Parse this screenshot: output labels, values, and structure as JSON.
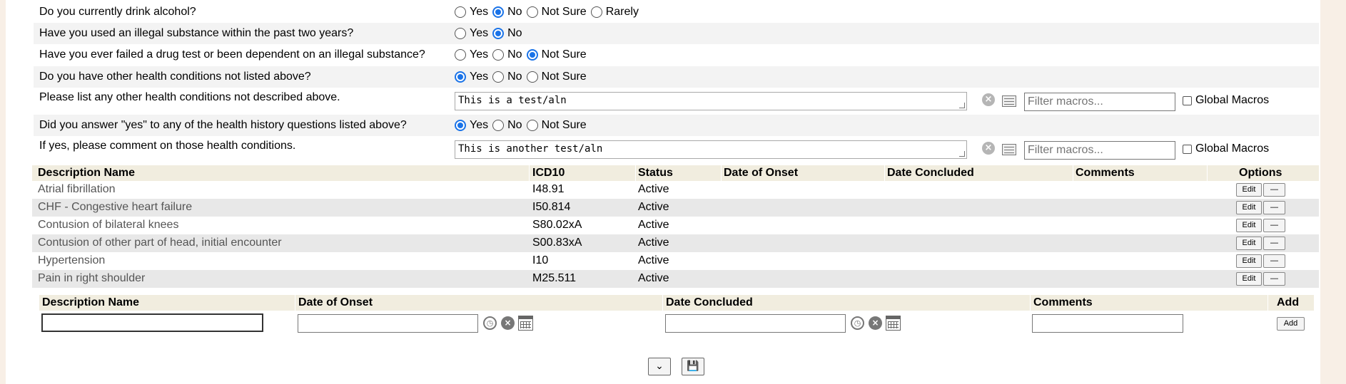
{
  "questions": [
    {
      "label": "Do you currently drink alcohol?",
      "options": [
        "Yes",
        "No",
        "Not Sure",
        "Rarely"
      ],
      "selected": "No"
    },
    {
      "label": "Have you used an illegal substance within the past two years?",
      "options": [
        "Yes",
        "No"
      ],
      "selected": "No"
    },
    {
      "label": "Have you ever failed a drug test or been dependent on an illegal substance?",
      "options": [
        "Yes",
        "No",
        "Not Sure"
      ],
      "selected": "Not Sure"
    },
    {
      "label": "Do you have other health conditions not listed above?",
      "options": [
        "Yes",
        "No",
        "Not Sure"
      ],
      "selected": "Yes"
    },
    {
      "label": "Did you answer \"yes\" to any of the health history questions listed above?",
      "options": [
        "Yes",
        "No",
        "Not Sure"
      ],
      "selected": "Yes"
    }
  ],
  "text_questions": [
    {
      "label": "Please list any other health conditions not described above.",
      "value": "This is a test/aln",
      "filter_placeholder": "Filter macros...",
      "global_label": "Global Macros"
    },
    {
      "label": "If yes, please comment on those health conditions.",
      "value": "This is another test/aln",
      "filter_placeholder": "Filter macros...",
      "global_label": "Global Macros"
    }
  ],
  "problems": {
    "headers": [
      "Description Name",
      "ICD10",
      "Status",
      "Date of Onset",
      "Date Concluded",
      "Comments",
      "Options"
    ],
    "rows": [
      {
        "desc": "Atrial fibrillation",
        "icd": "I48.91",
        "status": "Active"
      },
      {
        "desc": "CHF - Congestive heart failure",
        "icd": "I50.814",
        "status": "Active"
      },
      {
        "desc": "Contusion of bilateral knees",
        "icd": "S80.02xA",
        "status": "Active"
      },
      {
        "desc": "Contusion of other part of head, initial encounter",
        "icd": "S00.83xA",
        "status": "Active"
      },
      {
        "desc": "Hypertension",
        "icd": "I10",
        "status": "Active"
      },
      {
        "desc": "Pain in right shoulder",
        "icd": "M25.511",
        "status": "Active"
      }
    ],
    "edit_label": "Edit",
    "remove_label": "—"
  },
  "add_form": {
    "headers": [
      "Description Name",
      "Date of Onset",
      "Date Concluded",
      "Comments",
      "Add"
    ],
    "add_label": "Add"
  },
  "icons": {
    "clear": "x-circle-icon",
    "macros": "macro-list-icon",
    "clock": "clock-icon",
    "calendar": "calendar-icon",
    "expand": "chevron-double-down-icon",
    "save": "floppy-disk-icon"
  },
  "colors": {
    "radio_checked": "#1a73e8",
    "table_header": "#f1eddf",
    "row_shade": "#e8e8e8",
    "page_bg": "#f8efe6"
  }
}
